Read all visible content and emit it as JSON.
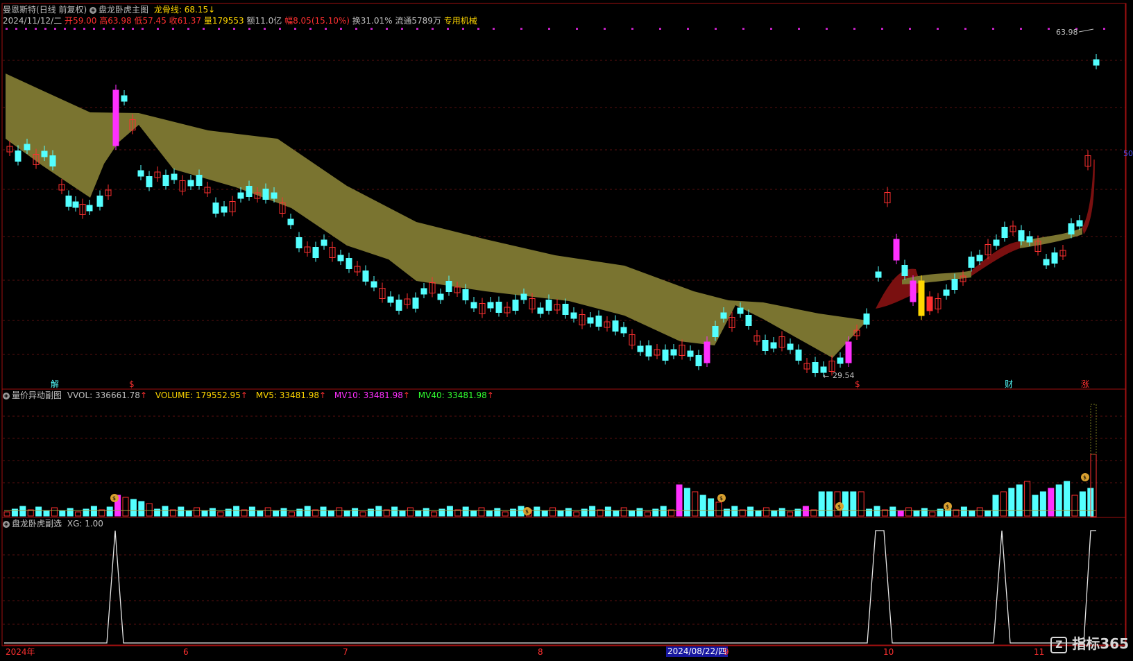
{
  "stock": {
    "name": "曼恩斯特",
    "period": "(日线 前复权)",
    "indicator_main": "盘龙卧虎主图",
    "dragon_line_label": "龙骨线: 68.15",
    "date": "2024/11/12/二",
    "open_label": "开",
    "open": "59.00",
    "high_label": "高",
    "high": "63.98",
    "low_label": "低",
    "low": "57.45",
    "close_label": "收",
    "close": "61.37",
    "vol_label": "量",
    "vol": "179553",
    "amount": "额11.0亿",
    "change_label": "幅",
    "change": "8.05(15.10%)",
    "turnover": "换31.01%",
    "float": "流通5789万",
    "industry": "专用机械"
  },
  "annotations": {
    "high_price": "63.98",
    "low_price": "29.54",
    "low_arrow": "←",
    "marker_jie": "解",
    "marker_s1": "$",
    "marker_s2": "$",
    "marker_cai": "财",
    "marker_zhang": "涨"
  },
  "volume_panel": {
    "title": "量价异动副图",
    "vvol": "VVOL: 336661.78",
    "volume": "VOLUME: 179552.95",
    "mv5": "MV5: 33481.98",
    "mv10": "MV10: 33481.98",
    "mv40": "MV40: 33481.98",
    "arrow": "↑"
  },
  "signal_panel": {
    "title": "盘龙卧虎副选",
    "xg": "XG: 1.00"
  },
  "timeline": {
    "year": "2024年",
    "m6": "6",
    "m7": "7",
    "m8": "8",
    "selected_date": "2024/08/22/四",
    "m9": "9",
    "m10": "10",
    "m11": "11"
  },
  "right_axis": {
    "v50": "50"
  },
  "watermark": "指标365",
  "colors": {
    "up": "#ff3030",
    "down": "#54ffff",
    "band_olive": "#7a7430",
    "band_red": "#7a1010",
    "magenta": "#ff30ff",
    "yellow": "#ffd700",
    "dots": "#c020c0"
  }
}
